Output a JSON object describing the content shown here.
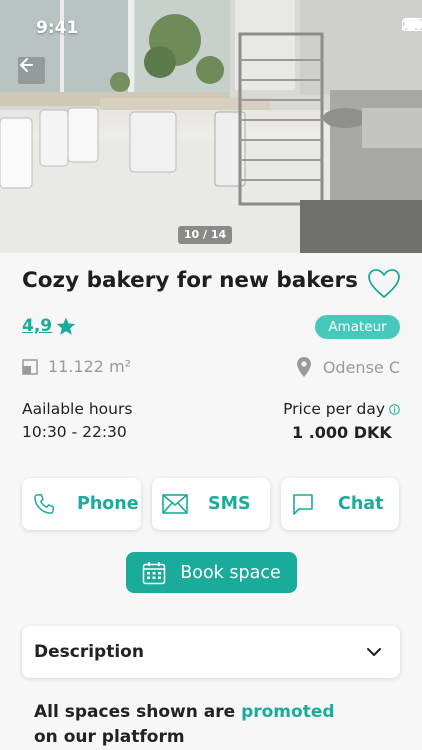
{
  "status_bar": {
    "time": "9:41"
  },
  "gallery": {
    "counter": "10 / 14"
  },
  "listing": {
    "title": "Cozy bakery for new bakers",
    "rating": "4,9",
    "badge": "Amateur",
    "area": "11.122 m²",
    "location": "Odense C",
    "hours_label": "Aailable hours",
    "hours_value": "10:30 - 22:30",
    "price_label": "Price per day",
    "price_value": "1 .000 DKK"
  },
  "contact": {
    "phone": "Phone",
    "sms": "SMS",
    "chat": "Chat"
  },
  "book_button": "Book space",
  "description": {
    "title": "Description"
  },
  "promo": {
    "before": "All spaces shown are ",
    "highlight": "promoted",
    "after": " on our platform"
  },
  "colors": {
    "accent": "#1aab9b",
    "badge": "#46c9ba",
    "muted": "#9a9a9a"
  },
  "icons": [
    "back-arrow-icon",
    "heart-icon",
    "star-icon",
    "area-icon",
    "location-pin-icon",
    "info-icon",
    "phone-icon",
    "mail-icon",
    "chat-icon",
    "calendar-icon",
    "chevron-down-icon"
  ]
}
